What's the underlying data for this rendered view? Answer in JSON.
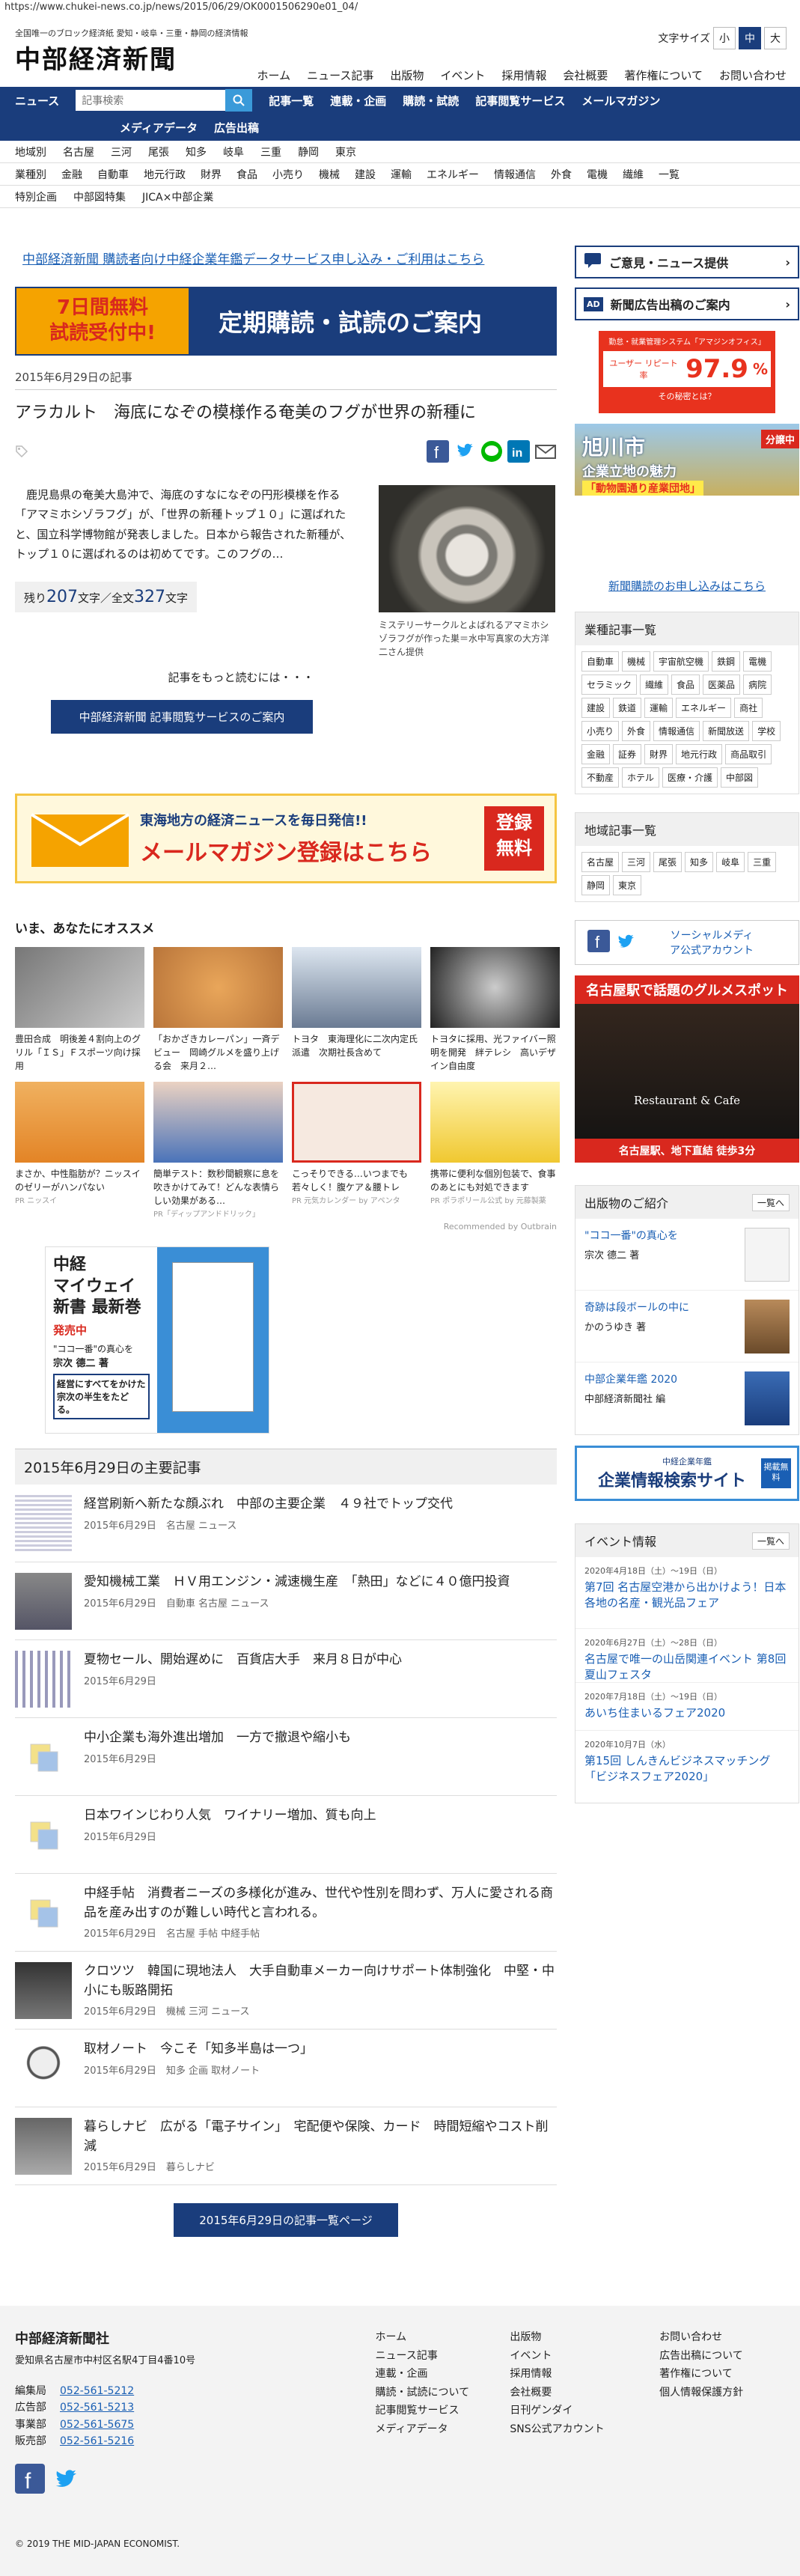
{
  "url": "https://www.chukei-news.co.jp/news/2015/06/29/OK0001506290e01_04/",
  "header": {
    "tagline": "全国唯一のブロック経済紙 愛知・岐阜・三重・静岡の経済情報",
    "logo": "中部経済新聞",
    "fontsize_label": "文字サイズ",
    "sizes": [
      "小",
      "中",
      "大"
    ],
    "nav": [
      "ホーム",
      "ニュース記事",
      "出版物",
      "イベント",
      "採用情報",
      "会社概要",
      "著作権について",
      "お問い合わせ"
    ]
  },
  "bluebar": {
    "news": "ニュース",
    "search_placeholder": "記事検索",
    "row1": [
      "記事一覧",
      "連載・企画",
      "購読・試読",
      "記事閲覧サービス",
      "メールマガジン"
    ],
    "row2": [
      "メディアデータ",
      "広告出稿"
    ]
  },
  "subnav": [
    [
      "地域別",
      "名古屋",
      "三河",
      "尾張",
      "知多",
      "岐阜",
      "三重",
      "静岡",
      "東京"
    ],
    [
      "業種別",
      "金融",
      "自動車",
      "地元行政",
      "財界",
      "食品",
      "小売り",
      "機械",
      "建設",
      "運輸",
      "エネルギー",
      "情報通信",
      "外食",
      "電機",
      "繊維",
      "一覧"
    ],
    [
      "特別企画",
      "中部図特集",
      "JICA×中部企業"
    ]
  ],
  "promo_link": "中部経済新聞 購読者向け中経企業年鑑データサービス申し込み・ご利用はこちら",
  "banner": {
    "left1": "7日間無料",
    "left2": "試読受付中!",
    "right": "定期購読・試読のご案内"
  },
  "article": {
    "date": "2015年6月29日の記事",
    "title": "アラカルト　海底になぞの模様作る奄美のフグが世界の新種に",
    "body": "鹿児島県の奄美大島沖で、海底のすなになぞの円形模様を作る「アマミホシゾラフグ」が、「世界の新種トップ１０」に選ばれたと、国立科学博物館が発表しました。日本から報告された新種が、トップ１０に選ばれるのは初めてです。このフグの…",
    "caption": "ミステリーサークルとよばれるアマミホシゾラフグが作った巣＝水中写真家の大方洋二さん提供",
    "count_pre": "残り",
    "count_rest": "207",
    "count_mid": "文字／全文",
    "count_all": "327",
    "count_post": "文字",
    "read_more": "記事をもっと読むには・・・",
    "service_btn": "中部経済新聞 記事閲覧サービスのご案内"
  },
  "mail_banner": {
    "top": "東海地方の経済ニュースを毎日発信!!",
    "main": "メールマガジン登録はこちら",
    "badge1": "登録",
    "badge2": "無料"
  },
  "recommend": {
    "heading": "いま、あなたにオススメ",
    "items": [
      {
        "text": "豊田合成　明後差４割向上のグリル「ＩＳ」Ｆスポーツ向け採用",
        "src": ""
      },
      {
        "text": "「おかざきカレーパン」一斉デビュー　岡崎グルメを盛り上げる会　来月２…",
        "src": ""
      },
      {
        "text": "トヨタ　東海理化に二次内定氏派遣　次期社長含めて",
        "src": ""
      },
      {
        "text": "トヨタに採用、光ファイバー照明を開発　絆テレシ　高いデザイン自由度",
        "src": ""
      },
      {
        "text": "まさか、中性脂肪が？ニッスイのゼリーがハンパない",
        "src": "PR ニッスイ"
      },
      {
        "text": "簡単テスト：数秒間観察に息を吹きかけてみて！どんな表情らしい効果がある…",
        "src": "PR「ディップアンドドリック」"
      },
      {
        "text": "こっそりできる…いつまでも若々しく！腹ケア＆腰トレ",
        "src": "PR 元気カレンダー by アペンタ"
      },
      {
        "text": "携帯に便利な個別包装で、食事のあとにも対処できます",
        "src": "PR ポラポリール公式 by 元藤製薬"
      }
    ],
    "outbrain": "Recommended by Outbrain"
  },
  "book": {
    "t1": "中経",
    "t2": "マイウェイ",
    "t3": "新書 最新巻",
    "t4": "発売中",
    "t5": "\"ココ一番\"の真心を",
    "t6": "宗次 德二 著",
    "t7": "経営にすべてをかけた宗次の半生をたどる。"
  },
  "latest": {
    "heading": "2015年6月29日の主要記事",
    "items": [
      {
        "title": "経営刷新へ新たな顔ぶれ　中部の主要企業　４９社でトップ交代",
        "date": "2015年6月29日",
        "tags": "名古屋 ニュース"
      },
      {
        "title": "愛知機械工業　ＨＶ用エンジン・減速機生産　「熱田」などに４０億円投資",
        "date": "2015年6月29日",
        "tags": "自動車 名古屋 ニュース"
      },
      {
        "title": "夏物セール、開始遅めに　百貨店大手　来月８日が中心",
        "date": "2015年6月29日",
        "tags": ""
      },
      {
        "title": "中小企業も海外進出増加　一方で撤退や縮小も",
        "date": "2015年6月29日",
        "tags": ""
      },
      {
        "title": "日本ワインじわり人気　ワイナリー増加、質も向上",
        "date": "2015年6月29日",
        "tags": ""
      },
      {
        "title": "中経手帖　消費者ニーズの多様化が進み、世代や性別を問わず、万人に愛される商品を産み出すのが難しい時代と言われる。",
        "date": "2015年6月29日",
        "tags": "名古屋 手帖 中経手帖"
      },
      {
        "title": "クロツツ　韓国に現地法人　大手自動車メーカー向けサポート体制強化　中堅・中小にも販路開拓",
        "date": "2015年6月29日",
        "tags": "機械 三河 ニュース"
      },
      {
        "title": "取材ノート　今こそ「知多半島は一つ」",
        "date": "2015年6月29日",
        "tags": "知多 企画 取材ノート"
      },
      {
        "title": "暮らしナビ　広がる「電子サイン」　宅配便や保険、カード　時間短縮やコスト削減",
        "date": "2015年6月29日",
        "tags": "暮らしナビ"
      }
    ],
    "list_btn": "2015年6月29日の記事一覧ページ"
  },
  "side": {
    "opinion": "ご意見・ニュース提供",
    "ad": "新聞広告出稿のご案内",
    "ad1": {
      "top": "勤怠・就業管理システム「アマジンオフィス」",
      "label": "ユーザー リピート率",
      "pct": "97.9",
      "unit": "%",
      "q": "その秘密とは？"
    },
    "ad2": {
      "l1": "旭川市",
      "l2": "企業立地の魅力",
      "l3": "「動物園通り産業団地」",
      "tag": "分譲中"
    },
    "subscribe_link": "新聞購読のお申し込みはこちら",
    "industry_h": "業種記事一覧",
    "industry": [
      "自動車",
      "機械",
      "宇宙航空機",
      "鉄鋼",
      "電機",
      "セラミック",
      "繊維",
      "食品",
      "医薬品",
      "病院",
      "建設",
      "鉄道",
      "運輸",
      "エネルギー",
      "商社",
      "小売り",
      "外食",
      "情報通信",
      "新聞放送",
      "学校",
      "金融",
      "証券",
      "財界",
      "地元行政",
      "商品取引",
      "不動産",
      "ホテル",
      "医療・介護",
      "中部図"
    ],
    "region_h": "地域記事一覧",
    "region": [
      "名古屋",
      "三河",
      "尾張",
      "知多",
      "岐阜",
      "三重",
      "静岡",
      "東京"
    ],
    "social": "ソーシャルメディア公式アカウント",
    "gourmet": {
      "top": "名古屋駅で話題のグルメスポット",
      "mid": "Restaurant & Cafe",
      "bottom": "名古屋駅、地下直結 徒歩3分"
    },
    "pubs_h": "出版物のご紹介",
    "pubs_more": "一覧へ",
    "pubs": [
      {
        "title": "\"ココ一番\"の真心を",
        "author": "宗次 德二 著"
      },
      {
        "title": "奇跡は段ボールの中に",
        "author": "かのうゆき 著"
      },
      {
        "title": "中部企業年鑑 2020",
        "author": "中部経済新聞社 編"
      }
    ],
    "nenkan": {
      "small": "中経企業年鑑",
      "main": "企業情報検索サイト",
      "badge": "掲載無料"
    },
    "events_h": "イベント情報",
    "events_more": "一覧へ",
    "events": [
      {
        "date": "2020年4月18日（土）～19日（日）",
        "title": "第7回 名古屋空港から出かけよう！日本各地の名産・観光品フェア"
      },
      {
        "date": "2020年6月27日（土）～28日（日）",
        "title": "名古屋で唯一の山岳関連イベント 第8回 夏山フェスタ"
      },
      {
        "date": "2020年7月18日（土）～19日（日）",
        "title": "あいち住まいるフェア2020"
      },
      {
        "date": "2020年10月7日（水）",
        "title": "第15回 しんきんビジネスマッチング「ビジネスフェア2020」"
      }
    ]
  },
  "footer": {
    "company": "中部経済新聞社",
    "address": "愛知県名古屋市中村区名駅4丁目4番10号",
    "phones": [
      {
        "label": "編集局",
        "num": "052-561-5212"
      },
      {
        "label": "広告部",
        "num": "052-561-5213"
      },
      {
        "label": "事業部",
        "num": "052-561-5675"
      },
      {
        "label": "販売部",
        "num": "052-561-5216"
      }
    ],
    "col1": [
      "ホーム",
      "ニュース記事",
      "連載・企画",
      "購読・試読について",
      "記事閲覧サービス",
      "メディアデータ"
    ],
    "col2": [
      "出版物",
      "イベント",
      "採用情報",
      "会社概要",
      "日刊ゲンダイ",
      "SNS公式アカウント"
    ],
    "col3": [
      "お問い合わせ",
      "広告出稿について",
      "著作権について",
      "個人情報保護方針"
    ],
    "copyright": "© 2019 THE MID-JAPAN ECONOMIST."
  },
  "colors": {
    "primary": "#1a3d7c",
    "link": "#1a5fb4",
    "accent_orange": "#f5a300",
    "red": "#d9281e"
  }
}
